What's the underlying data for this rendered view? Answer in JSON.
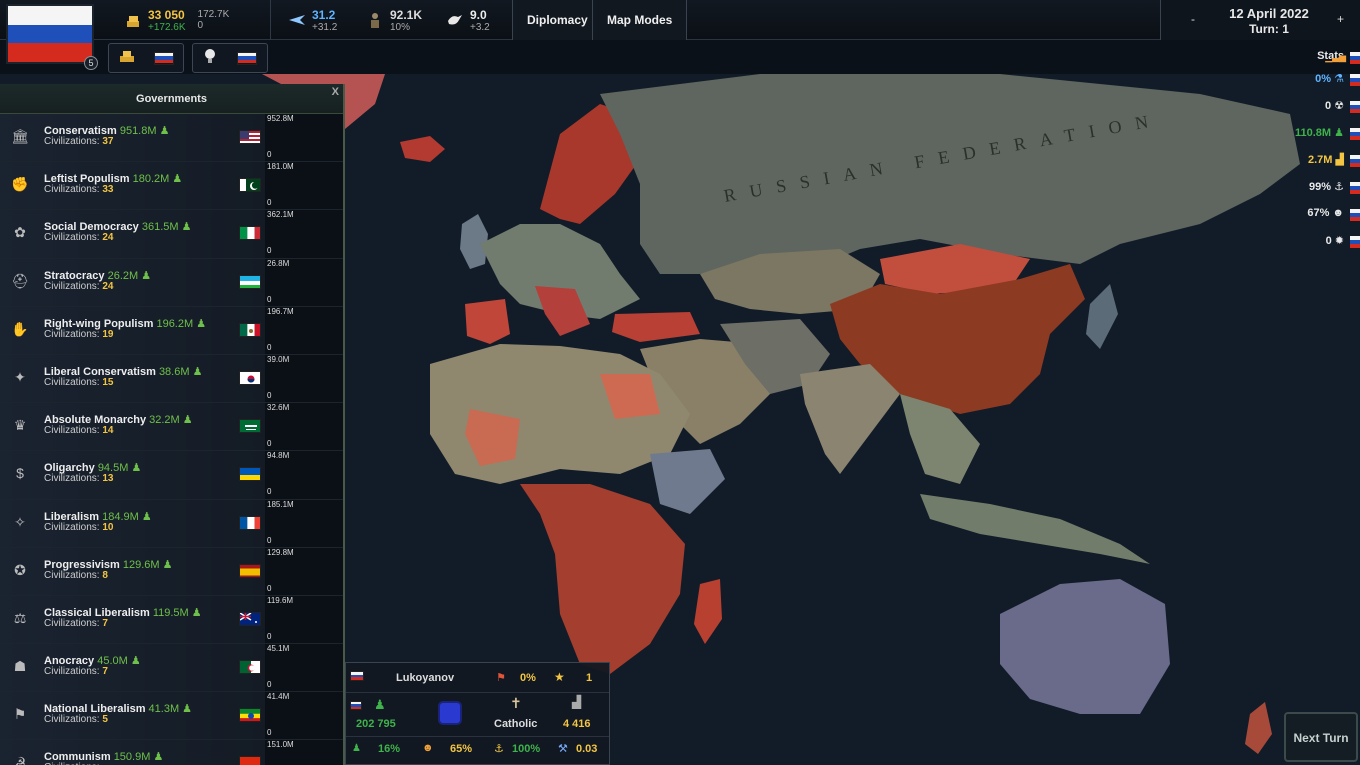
{
  "top": {
    "gold": "33 050",
    "gold_delta": "+172.6K",
    "treasury_a": "172.7K",
    "treasury_b": "0",
    "tech": "31.2",
    "tech_delta": "+31.2",
    "military": "92.1K",
    "military_pct": "10%",
    "peace": "9.0",
    "peace_delta": "+3.2",
    "diplomacy": "Diplomacy",
    "map_modes": "Map Modes",
    "flag_badge": "5",
    "date": "12 April 2022",
    "turn": "Turn: 1",
    "minus": "-",
    "plus": "+"
  },
  "colors": {
    "russia_white": "#f5f5f5",
    "russia_blue": "#1f4fb8",
    "russia_red": "#d52b1e",
    "positive": "#3fb24b",
    "gold": "#f3c542"
  },
  "governments": {
    "title": "Governments",
    "close": "X",
    "civ_prefix": "Civilizations: ",
    "rows": [
      {
        "name": "Conservatism",
        "pop": "951.8M",
        "civs": "37",
        "flag": "USA",
        "max": "952.8M",
        "min": "0",
        "icon": "columns-icon"
      },
      {
        "name": "Leftist Populism",
        "pop": "180.2M",
        "civs": "33",
        "flag": "Pakistan",
        "max": "181.0M",
        "min": "0",
        "icon": "fist-icon"
      },
      {
        "name": "Social Democracy",
        "pop": "361.5M",
        "civs": "24",
        "flag": "Italy",
        "max": "362.1M",
        "min": "0",
        "icon": "rose-icon"
      },
      {
        "name": "Stratocracy",
        "pop": "26.2M",
        "civs": "24",
        "flag": "Uzbekistan",
        "max": "26.8M",
        "min": "0",
        "icon": "helmet-icon"
      },
      {
        "name": "Right-wing Populism",
        "pop": "196.2M",
        "civs": "19",
        "flag": "Mexico",
        "max": "196.7M",
        "min": "0",
        "icon": "crowd-icon"
      },
      {
        "name": "Liberal Conservatism",
        "pop": "38.6M",
        "civs": "15",
        "flag": "South Korea",
        "max": "39.0M",
        "min": "0",
        "icon": "eagle-icon"
      },
      {
        "name": "Absolute Monarchy",
        "pop": "32.2M",
        "civs": "14",
        "flag": "Saudi Arabia",
        "max": "32.6M",
        "min": "0",
        "icon": "crown-icon"
      },
      {
        "name": "Oligarchy",
        "pop": "94.5M",
        "civs": "13",
        "flag": "Ukraine",
        "max": "94.8M",
        "min": "0",
        "icon": "money-icon"
      },
      {
        "name": "Liberalism",
        "pop": "184.9M",
        "civs": "10",
        "flag": "France",
        "max": "185.1M",
        "min": "0",
        "icon": "torch-icon"
      },
      {
        "name": "Progressivism",
        "pop": "129.6M",
        "civs": "8",
        "flag": "Spain",
        "max": "129.8M",
        "min": "0",
        "icon": "megaphone-icon"
      },
      {
        "name": "Classical Liberalism",
        "pop": "119.5M",
        "civs": "7",
        "flag": "Australia",
        "max": "119.6M",
        "min": "0",
        "icon": "scales-icon"
      },
      {
        "name": "Anocracy",
        "pop": "45.0M",
        "civs": "7",
        "flag": "Algeria",
        "max": "45.1M",
        "min": "0",
        "icon": "mask-icon"
      },
      {
        "name": "National Liberalism",
        "pop": "41.3M",
        "civs": "5",
        "flag": "Ethiopia",
        "max": "41.4M",
        "min": "0",
        "icon": "banner-icon"
      },
      {
        "name": "Communism",
        "pop": "150.9M",
        "civs": "",
        "flag": "China",
        "max": "151.0M",
        "min": "",
        "icon": "hammer-icon"
      }
    ]
  },
  "stats": {
    "label": "Stats",
    "rows": [
      {
        "value": "0%",
        "icon": "flask-icon",
        "color": "#5fb3ff"
      },
      {
        "value": "0",
        "icon": "nuclear-icon",
        "color": "#e8e8e8"
      },
      {
        "value": "110.8M",
        "icon": "population-icon",
        "color": "#3fb24b"
      },
      {
        "value": "2.7M",
        "icon": "factory-icon",
        "color": "#f3c542"
      },
      {
        "value": "99%",
        "icon": "anchor-icon",
        "color": "#e8e8e8"
      },
      {
        "value": "67%",
        "icon": "happy-icon",
        "color": "#e8e8e8"
      },
      {
        "value": "0",
        "icon": "emblem-icon",
        "color": "#e8e8e8"
      }
    ]
  },
  "map": {
    "label": "RUSSIAN FEDERATION"
  },
  "info": {
    "leader": "Lukoyanov",
    "unrest": "0%",
    "stars": "1",
    "population": "202 795",
    "religion": "Catholic",
    "industry": "4 416",
    "growth": "16%",
    "happiness": "65%",
    "stability": "100%",
    "corruption": "0.03"
  },
  "next_turn": "Next Turn"
}
